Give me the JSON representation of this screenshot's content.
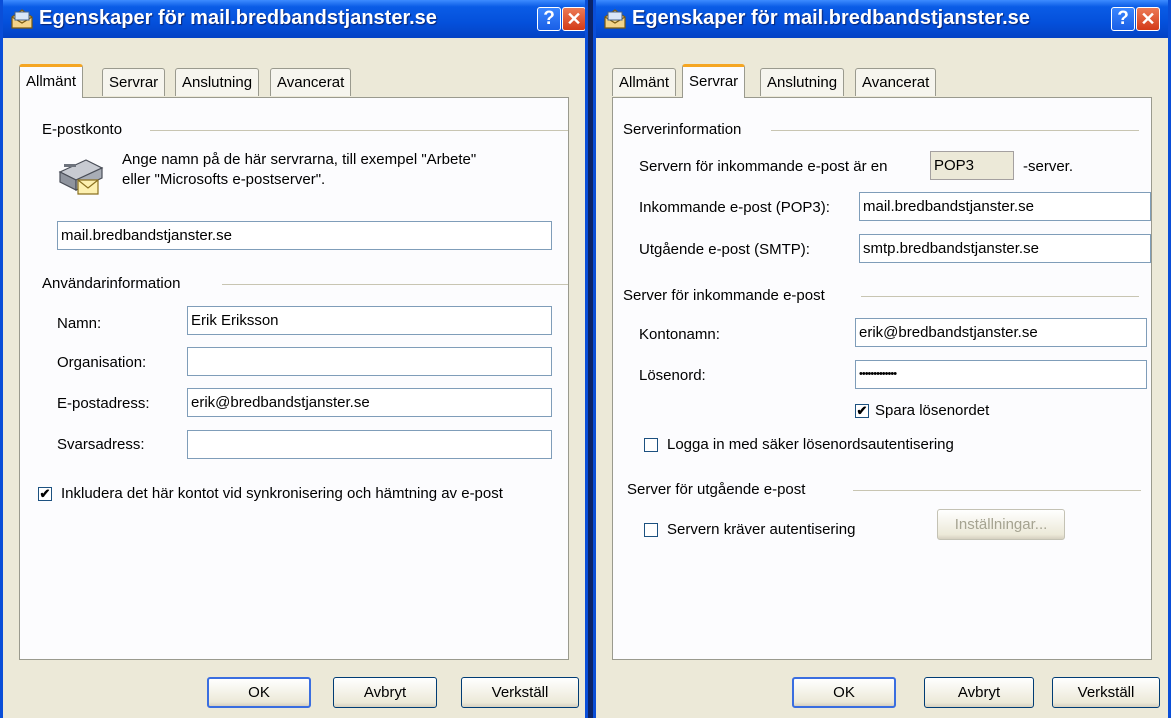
{
  "left": {
    "title": "Egenskaper för mail.bredbandstjanster.se",
    "tabs": [
      "Allmänt",
      "Servrar",
      "Anslutning",
      "Avancerat"
    ],
    "mail_account": {
      "heading": "E-postkonto",
      "description_line1": "Ange namn på de här servrarna, till exempel \"Arbete\"",
      "description_line2": "eller \"Microsofts e-postserver\".",
      "account_name": "mail.bredbandstjanster.se"
    },
    "user_info": {
      "heading": "Användarinformation",
      "name_label": "Namn:",
      "name_value": "Erik Eriksson",
      "org_label": "Organisation:",
      "org_value": "",
      "email_label": "E-postadress:",
      "email_value": "erik@bredbandstjanster.se",
      "reply_label": "Svarsadress:",
      "reply_value": ""
    },
    "include_label": "Inkludera det här kontot vid synkronisering och hämtning av e-post",
    "include_checked": true,
    "buttons": {
      "ok": "OK",
      "cancel": "Avbryt",
      "apply": "Verkställ"
    }
  },
  "right": {
    "title": "Egenskaper för mail.bredbandstjanster.se",
    "tabs": [
      "Allmänt",
      "Servrar",
      "Anslutning",
      "Avancerat"
    ],
    "server_info": {
      "heading": "Serverinformation",
      "incoming_type_prefix": "Servern för inkommande e-post är en",
      "incoming_type_value": "POP3",
      "incoming_type_suffix": "-server.",
      "incoming_label": "Inkommande e-post (POP3):",
      "incoming_value": "mail.bredbandstjanster.se",
      "outgoing_label": "Utgående e-post (SMTP):",
      "outgoing_value": "smtp.bredbandstjanster.se"
    },
    "incoming_server": {
      "heading": "Server för inkommande e-post",
      "account_label": "Kontonamn:",
      "account_value": "erik@bredbandstjanster.se",
      "password_label": "Lösenord:",
      "password_value": "•••••••••••••",
      "save_password_label": "Spara lösenordet",
      "save_password_checked": true,
      "spa_label": "Logga in med säker lösenordsautentisering",
      "spa_checked": false
    },
    "outgoing_server": {
      "heading": "Server för utgående e-post",
      "auth_label": "Servern kräver autentisering",
      "auth_checked": false,
      "settings_button": "Inställningar..."
    },
    "buttons": {
      "ok": "OK",
      "cancel": "Avbryt",
      "apply": "Verkställ"
    }
  },
  "icons": {
    "title_icon": "mail-account-icon",
    "account_icon": "mail-server-icon",
    "help": "?",
    "close": "✕"
  }
}
